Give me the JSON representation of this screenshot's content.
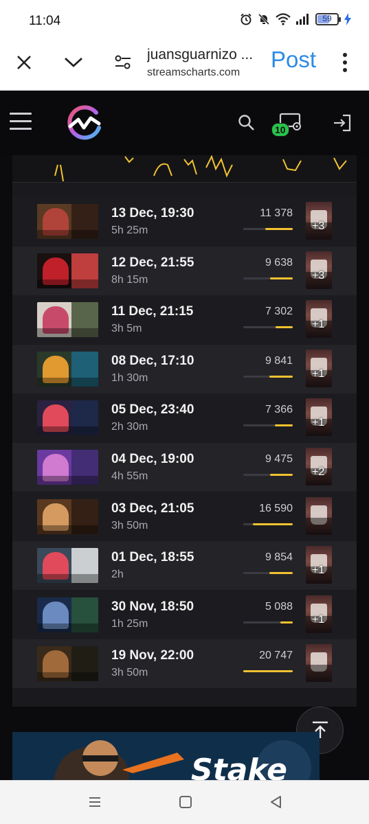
{
  "status_bar": {
    "time": "11:04",
    "battery_level": "59",
    "battery_fraction": 0.59
  },
  "browser": {
    "tab_title": "juansguarnizo ...",
    "host": "streamscharts.com",
    "post_label": "Post"
  },
  "site_header": {
    "streams_badge_count": "10"
  },
  "streams": [
    {
      "date": "13 Dec, 19:30",
      "duration": "5h 25m",
      "viewers": "11 378",
      "viewer_fraction": 0.55,
      "extra": "+3"
    },
    {
      "date": "12 Dec, 21:55",
      "duration": "8h 15m",
      "viewers": "9 638",
      "viewer_fraction": 0.46,
      "extra": "+3"
    },
    {
      "date": "11 Dec, 21:15",
      "duration": "3h 5m",
      "viewers": "7 302",
      "viewer_fraction": 0.35,
      "extra": "+1"
    },
    {
      "date": "08 Dec, 17:10",
      "duration": "1h 30m",
      "viewers": "9 841",
      "viewer_fraction": 0.47,
      "extra": "+1"
    },
    {
      "date": "05 Dec, 23:40",
      "duration": "2h 30m",
      "viewers": "7 366",
      "viewer_fraction": 0.36,
      "extra": "+1"
    },
    {
      "date": "04 Dec, 19:00",
      "duration": "4h 55m",
      "viewers": "9 475",
      "viewer_fraction": 0.46,
      "extra": "+2"
    },
    {
      "date": "03 Dec, 21:05",
      "duration": "3h 50m",
      "viewers": "16 590",
      "viewer_fraction": 0.8,
      "extra": ""
    },
    {
      "date": "01 Dec, 18:55",
      "duration": "2h",
      "viewers": "9 854",
      "viewer_fraction": 0.47,
      "extra": "+1"
    },
    {
      "date": "30 Nov, 18:50",
      "duration": "1h 25m",
      "viewers": "5 088",
      "viewer_fraction": 0.25,
      "extra": "+1"
    },
    {
      "date": "19 Nov, 22:00",
      "duration": "3h 50m",
      "viewers": "20 747",
      "viewer_fraction": 1.0,
      "extra": ""
    }
  ],
  "ad": {
    "brand_text": "Stake"
  },
  "colors": {
    "accent_bar": "#f2c230",
    "badge_green": "#27c44a",
    "post_blue": "#2d8be6"
  }
}
